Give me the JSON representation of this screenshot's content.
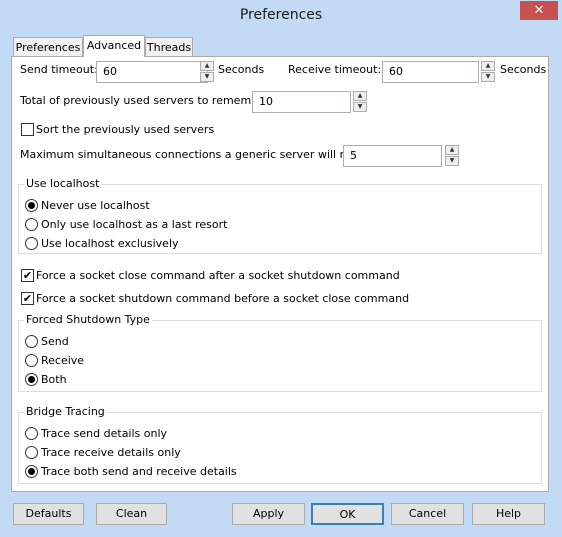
{
  "window": {
    "title": "Preferences",
    "close_glyph": "✕"
  },
  "tabs": [
    {
      "label": "Preferences"
    },
    {
      "label": "Advanced",
      "active": true
    },
    {
      "label": "Threads"
    }
  ],
  "advanced": {
    "send_timeout": {
      "label": "Send timeout:",
      "value": "60",
      "unit": "Seconds"
    },
    "receive_timeout": {
      "label": "Receive timeout:",
      "value": "60",
      "unit": "Seconds"
    },
    "servers_to_remember": {
      "label": "Total of previously used servers to remember:",
      "value": "10"
    },
    "sort_servers": {
      "label": "Sort the previously used servers",
      "checked": false
    },
    "max_connections": {
      "label": "Maximum simultaneous connections a generic server will maintain:",
      "value": "5"
    },
    "localhost": {
      "title": "Use localhost",
      "options": [
        {
          "label": "Never use localhost",
          "selected": true
        },
        {
          "label": "Only use localhost as a last resort",
          "selected": false
        },
        {
          "label": "Use localhost exclusively",
          "selected": false
        }
      ]
    },
    "force_close": {
      "label": "Force a socket close command after a socket shutdown command",
      "checked": true,
      "glyph": "✔"
    },
    "force_shutdown": {
      "label": "Force a socket shutdown command before a socket close command",
      "checked": true,
      "glyph": "✔"
    },
    "shutdown_type": {
      "title": "Forced Shutdown Type",
      "options": [
        {
          "label": "Send",
          "selected": false
        },
        {
          "label": "Receive",
          "selected": false
        },
        {
          "label": "Both",
          "selected": true
        }
      ]
    },
    "bridge_tracing": {
      "title": "Bridge Tracing",
      "options": [
        {
          "label": "Trace send details only",
          "selected": false
        },
        {
          "label": "Trace receive details only",
          "selected": false
        },
        {
          "label": "Trace both send and receive details",
          "selected": true
        }
      ]
    }
  },
  "spin_glyphs": {
    "up": "▲",
    "down": "▼"
  },
  "buttons": {
    "defaults": "Defaults",
    "clean": "Clean",
    "apply": "Apply",
    "ok": "OK",
    "cancel": "Cancel",
    "help": "Help"
  }
}
